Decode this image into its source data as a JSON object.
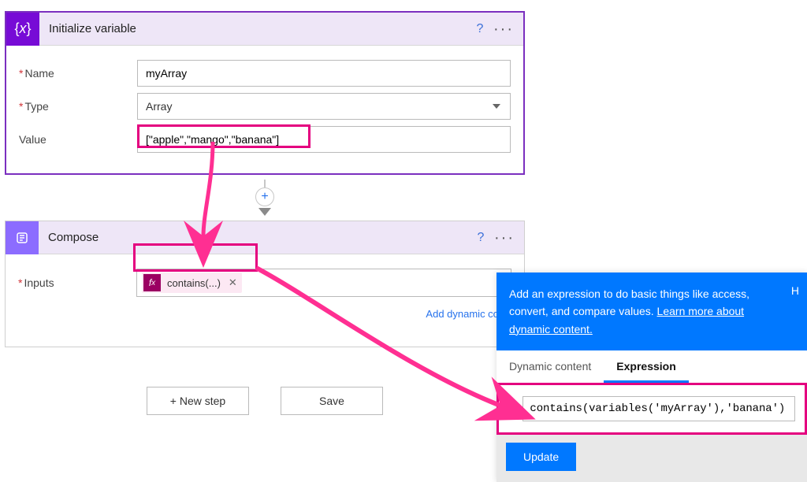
{
  "step1": {
    "title": "Initialize variable",
    "fields": {
      "name_label": "Name",
      "name_value": "myArray",
      "type_label": "Type",
      "type_value": "Array",
      "value_label": "Value",
      "value_value": "[\"apple\",\"mango\",\"banana\"]"
    }
  },
  "step2": {
    "title": "Compose",
    "inputs_label": "Inputs",
    "token_label": "contains(...)",
    "add_dynamic": "Add dynamic conte"
  },
  "footer": {
    "new_step": "+ New step",
    "save": "Save"
  },
  "expr": {
    "tip_1": "Add an expression to do basic things like access, convert, and compare values. ",
    "tip_learn": "Learn more about dynamic content.",
    "tip_hide": "H",
    "tabs": {
      "dynamic": "Dynamic content",
      "expr": "Expression"
    },
    "formula": "contains(variables('myArray'),'banana')",
    "update": "Update"
  }
}
